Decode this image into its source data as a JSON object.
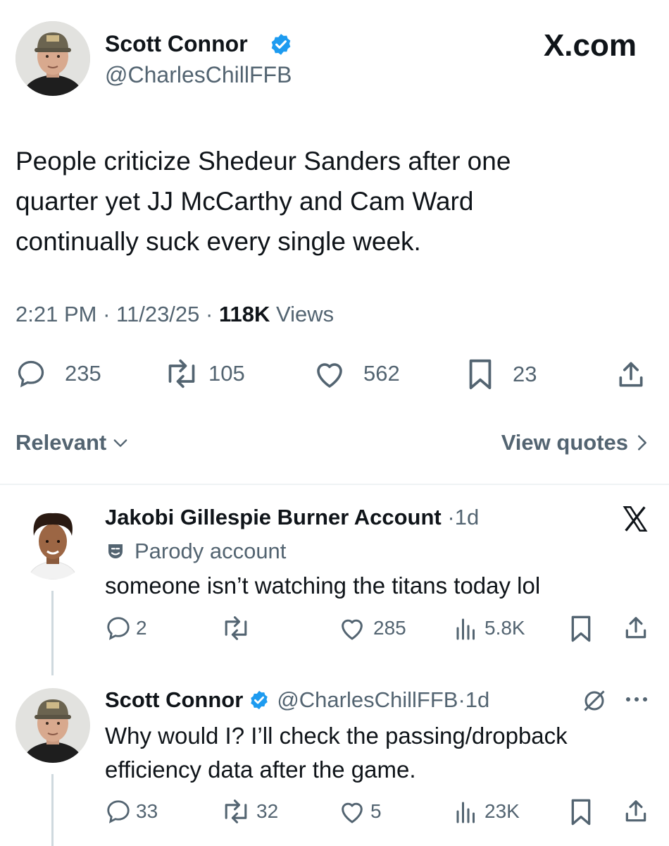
{
  "main_tweet": {
    "author_name": "Scott Connor",
    "author_handle": "@CharlesChillFFB",
    "brand": "X.com",
    "text_lines": [
      "People criticize Shedeur Sanders  after one",
      "quarter yet JJ McCarthy and Cam Ward",
      "continually suck every single week."
    ],
    "time": "2:21 PM",
    "date": "11/23/25",
    "views_count": "118K",
    "views_label": "Views",
    "stats": {
      "replies": "235",
      "reposts": "105",
      "likes": "562",
      "bookmarks": "23"
    }
  },
  "filter": {
    "sort_label": "Relevant",
    "view_quotes_label": "View quotes"
  },
  "replies": [
    {
      "author_name": "Jakobi Gillespie Burner Account",
      "age": "1d",
      "badge_label": "Parody account",
      "text": "someone isn’t watching the titans today lol",
      "stats": {
        "replies": "2",
        "reposts": "",
        "likes": "285",
        "views": "5.8K"
      }
    },
    {
      "author_name": "Scott Connor",
      "author_handle": "@CharlesChillFFB",
      "age": "1d",
      "text_lines": [
        "Why would I? I’ll check the passing/dropback",
        "efficiency data after the game."
      ],
      "stats": {
        "replies": "33",
        "reposts": "32",
        "likes": "5",
        "views": "23K"
      }
    }
  ],
  "colors": {
    "verified": "#1d9bf0",
    "muted": "#536471",
    "divider": "#eff3f4",
    "thread_line": "#cfd9de"
  }
}
